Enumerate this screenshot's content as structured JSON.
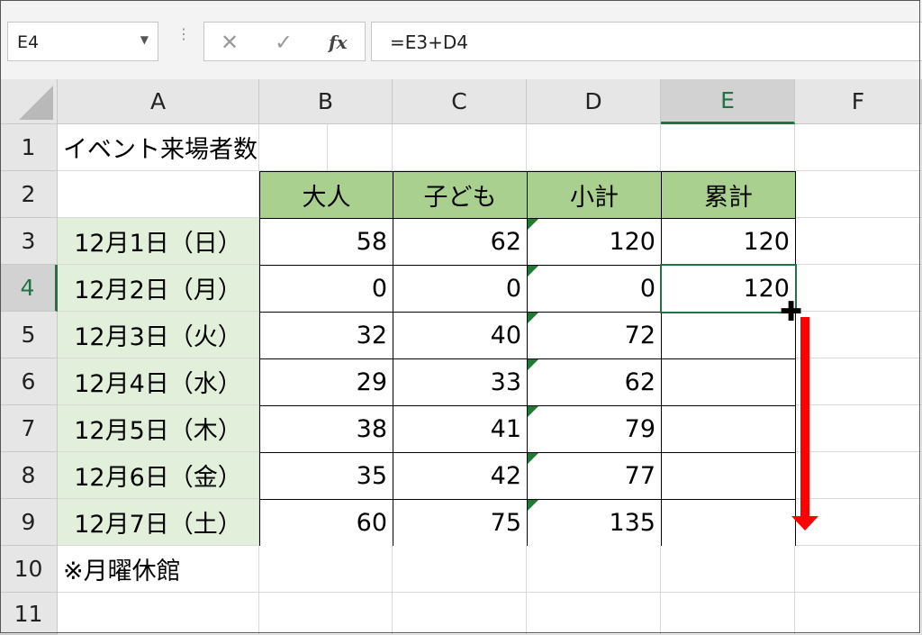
{
  "formula_bar": {
    "name_box": "E4",
    "cancel_icon": "✕",
    "confirm_icon": "✓",
    "fx_label": "fx",
    "formula": "=E3+D4"
  },
  "columns": [
    "A",
    "B",
    "C",
    "D",
    "E",
    "F"
  ],
  "rows": [
    "1",
    "2",
    "3",
    "4",
    "5",
    "6",
    "7",
    "8",
    "9",
    "10",
    "11"
  ],
  "sheet": {
    "title": "イベント来場者数",
    "headers": [
      "大人",
      "子ども",
      "小計",
      "累計"
    ],
    "data_rows": [
      {
        "date": "12月1日（日）",
        "adult": "58",
        "child": "62",
        "subtotal": "120",
        "cumulative": "120"
      },
      {
        "date": "12月2日（月）",
        "adult": "0",
        "child": "0",
        "subtotal": "0",
        "cumulative": "120"
      },
      {
        "date": "12月3日（火）",
        "adult": "32",
        "child": "40",
        "subtotal": "72",
        "cumulative": ""
      },
      {
        "date": "12月4日（水）",
        "adult": "29",
        "child": "33",
        "subtotal": "62",
        "cumulative": ""
      },
      {
        "date": "12月5日（木）",
        "adult": "38",
        "child": "41",
        "subtotal": "79",
        "cumulative": ""
      },
      {
        "date": "12月6日（金）",
        "adult": "35",
        "child": "42",
        "subtotal": "77",
        "cumulative": ""
      },
      {
        "date": "12月7日（土）",
        "adult": "60",
        "child": "75",
        "subtotal": "135",
        "cumulative": ""
      }
    ],
    "note": "※月曜休館"
  },
  "selected_cell": "E4",
  "icons": {
    "fill_cursor": "fill-handle-crosshair-icon",
    "drag_arrow": "down-arrow-icon"
  },
  "colors": {
    "header_fill": "#a9d08e",
    "date_fill": "#e2efda",
    "selection": "#217346",
    "arrow": "#ff0000"
  }
}
